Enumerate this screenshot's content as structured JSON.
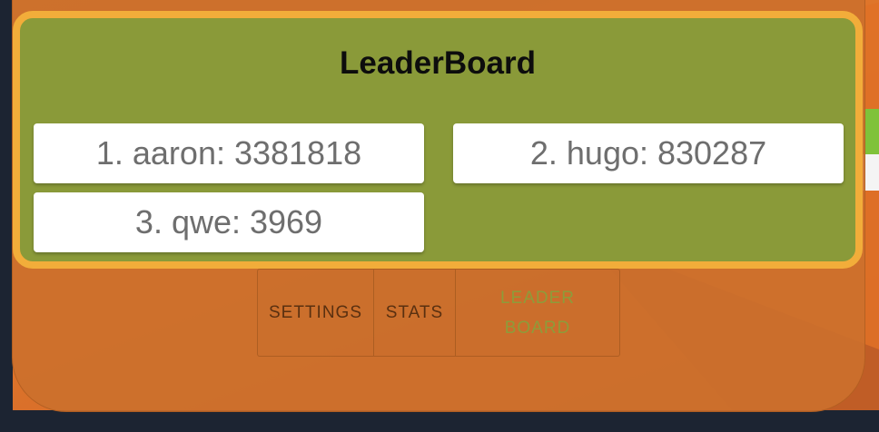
{
  "leaderboard": {
    "title": "LeaderBoard",
    "entries": [
      {
        "text": "1. aaron: 3381818"
      },
      {
        "text": "2. hugo: 830287"
      },
      {
        "text": "3. qwe: 3969"
      }
    ]
  },
  "tabs": {
    "settings": "SETTINGS",
    "stats": "STATS",
    "leaderboard": "LEADER BOARD",
    "active": "leaderboard"
  },
  "colors": {
    "panel_bg": "#cc702c",
    "card_bg": "#8a9a39",
    "card_border": "#f2ad3a",
    "entry_bg": "#ffffff",
    "entry_text": "#6e6e6e",
    "active_tab_text": "#8d9c3a"
  }
}
